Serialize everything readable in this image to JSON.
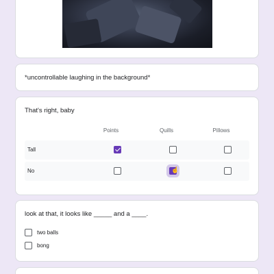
{
  "image_card": {
    "image_name": "dark-rocky-cave-photo"
  },
  "caption_card": {
    "text": "*uncontrollable laughing in the background*"
  },
  "grid_question": {
    "title": "That's right, baby",
    "columns": [
      "Points",
      "Quills",
      "Pillows"
    ],
    "rows": [
      {
        "label": "Tall",
        "checked": [
          true,
          false,
          false
        ]
      },
      {
        "label": "No",
        "checked": [
          false,
          true,
          false
        ]
      }
    ]
  },
  "checkbox_question": {
    "title": "look at that, it looks like _____ and a ____.",
    "options": [
      {
        "label": "two balls",
        "checked": false
      },
      {
        "label": "bong",
        "checked": false
      }
    ]
  },
  "colors": {
    "accent": "#673ab7",
    "background": "#ede7f6"
  }
}
